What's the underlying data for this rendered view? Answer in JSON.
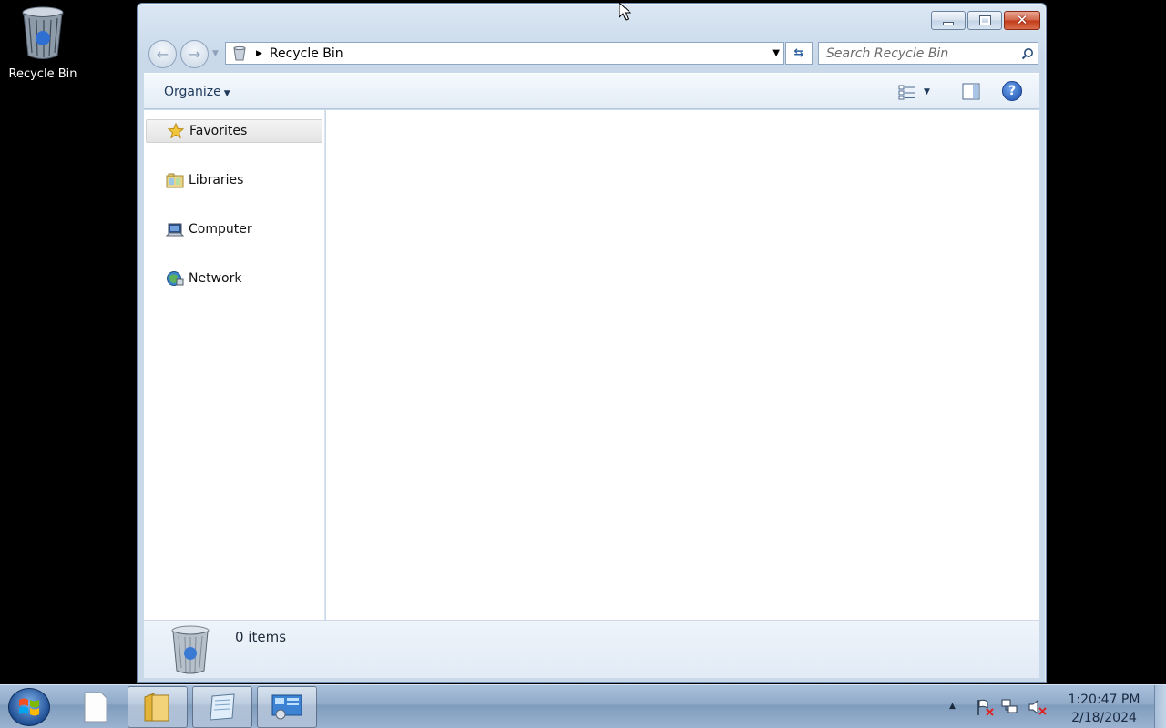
{
  "desktop": {
    "recycle_bin_label": "Recycle Bin"
  },
  "window": {
    "address": {
      "location": "Recycle Bin"
    },
    "search": {
      "placeholder": "Search Recycle Bin"
    },
    "toolbar": {
      "organize_label": "Organize"
    },
    "nav_pane": {
      "items": [
        {
          "label": "Favorites",
          "icon": "star-icon"
        },
        {
          "label": "Libraries",
          "icon": "libraries-icon"
        },
        {
          "label": "Computer",
          "icon": "computer-icon"
        },
        {
          "label": "Network",
          "icon": "network-icon"
        }
      ]
    },
    "details": {
      "item_count": "0 items"
    }
  },
  "taskbar": {
    "clock": {
      "time": "1:20:47 PM",
      "date": "2/18/2024"
    }
  },
  "colors": {
    "desktop": "#000000",
    "close_button": "#c23a18",
    "taskbar": "#8fa9c8"
  }
}
